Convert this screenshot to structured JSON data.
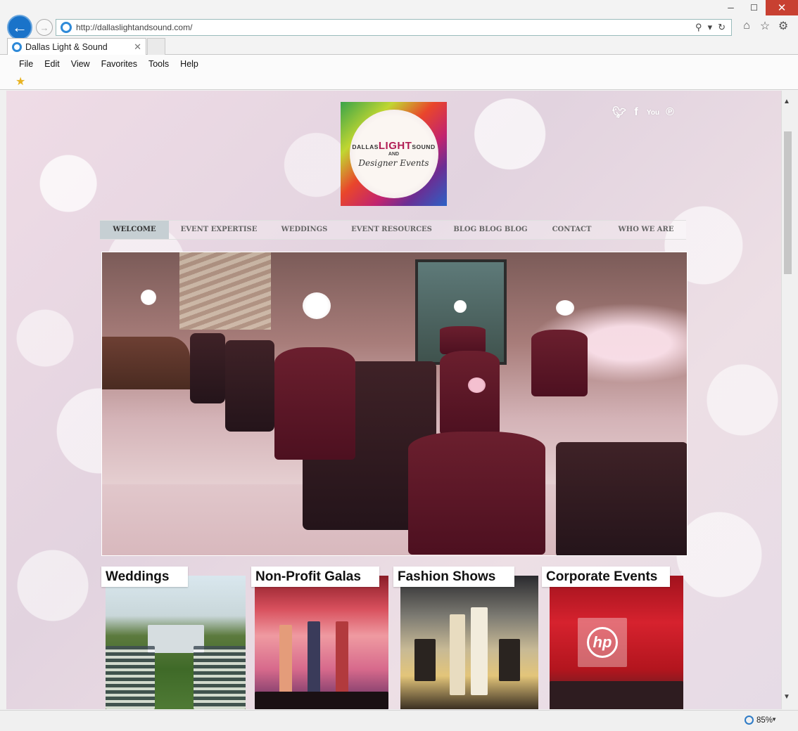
{
  "browser": {
    "url": "http://dallaslightandsound.com/",
    "tab_title": "Dallas Light & Sound",
    "menu": [
      "File",
      "Edit",
      "View",
      "Favorites",
      "Tools",
      "Help"
    ],
    "zoom": "85%",
    "window_controls": {
      "minimize": "─",
      "maximize": "☐",
      "close": "✕"
    }
  },
  "site": {
    "logo": {
      "line1_left": "DALLAS",
      "line1_mid": "LIGHT",
      "line1_right": "SOUND",
      "and": "AND",
      "script": "Designer Events"
    },
    "social": [
      "twitter-icon",
      "facebook-icon",
      "youtube-icon",
      "pinterest-icon"
    ],
    "nav": [
      {
        "label": "WELCOME",
        "active": true
      },
      {
        "label": "EVENT EXPERTISE",
        "active": false
      },
      {
        "label": "WEDDINGS",
        "active": false
      },
      {
        "label": "EVENT RESOURCES",
        "active": false
      },
      {
        "label": "BLOG BLOG BLOG",
        "active": false
      },
      {
        "label": "CONTACT",
        "active": false
      },
      {
        "label": "WHO WE ARE",
        "active": false
      }
    ],
    "events": [
      {
        "label": "Weddings"
      },
      {
        "label": "Non-Profit Galas"
      },
      {
        "label": "Fashion Shows"
      },
      {
        "label": "Corporate Events"
      }
    ],
    "corporate_sign": "hp"
  },
  "colors": {
    "nav_active_bg": "#c6cfd3",
    "browser_close_bg": "#c84031",
    "back_button": "#1a73c9"
  }
}
